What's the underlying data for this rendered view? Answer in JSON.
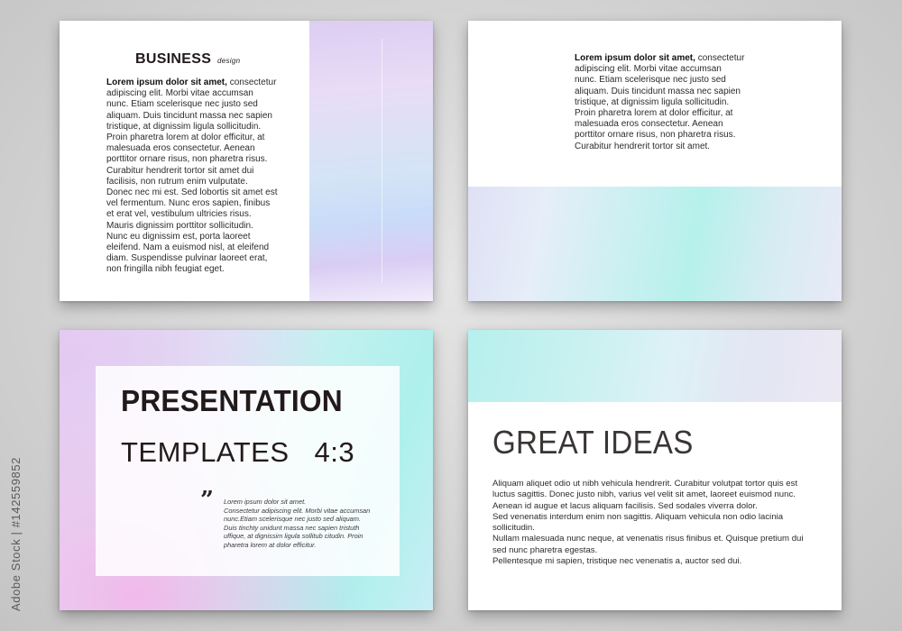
{
  "credit": "Adobe Stock | #142559852",
  "slide1": {
    "heading": "BUSINESS",
    "subheading": "design",
    "lead": "Lorem ipsum dolor sit amet,",
    "lines": [
      "adipiscing elit. Morbi vitae accumsan",
      "nunc. Etiam scelerisque nec justo sed",
      "aliquam. Duis tincidunt massa nec sapien",
      "tristique, at dignissim ligula sollicitudin.",
      "Proin pharetra lorem at dolor efficitur, at",
      "malesuada eros consectetur. Aenean",
      "porttitor ornare risus, non pharetra risus.",
      "Curabitur hendrerit tortor sit amet dui",
      "facilisis, non rutrum enim vulputate.",
      "Donec nec mi est. Sed lobortis sit amet est",
      "vel fermentum. Nunc eros sapien, finibus",
      "et erat vel, vestibulum ultricies risus.",
      "Mauris dignissim porttitor sollicitudin.",
      "Nunc eu dignissim est, porta laoreet",
      "eleifend. Nam a euismod nisl, at eleifend",
      "diam. Suspendisse pulvinar laoreet erat,",
      "non fringilla nibh feugiat eget."
    ],
    "lead_rest": " consectetur"
  },
  "slide2": {
    "lead": "Lorem ipsum dolor sit amet,",
    "lead_rest": " consectetur",
    "lines": [
      "adipiscing elit. Morbi vitae accumsan",
      "nunc. Etiam scelerisque nec justo sed",
      "aliquam. Duis tincidunt massa nec sapien",
      "tristique, at dignissim ligula sollicitudin.",
      "Proin pharetra lorem at dolor efficitur, at",
      "malesuada eros consectetur. Aenean",
      "porttitor ornare risus, non pharetra risus.",
      "Curabitur hendrerit tortor sit amet."
    ]
  },
  "slide3": {
    "title_line1": "PRESENTATION",
    "title_line2": "TEMPLATES",
    "ratio": "4:3",
    "quote_mark": "”",
    "quote_lines": [
      "Lorem ipsum dolor sit amet.",
      "Consectetur adipiscing elit. Morbi vitae accumsan",
      "nunc.Etiam scelerisque nec justo sed aliquam.",
      "Duis tinchty unidunt massa nec sapien tristuth",
      "uffique, at dignissim ligula sollitub citudin. Proin",
      "pharetra lorem at dolor efficitur."
    ]
  },
  "slide4": {
    "title": "GREAT IDEAS",
    "lines": [
      "Aliquam aliquet odio ut nibh vehicula hendrerit. Curabitur volutpat tortor quis est",
      "luctus sagittis. Donec justo nibh, varius vel velit sit amet, laoreet euismod nunc.",
      "Aenean id augue et lacus aliquam facilisis. Sed sodales viverra dolor.",
      "Sed venenatis interdum enim non sagittis. Aliquam vehicula non odio lacinia",
      "sollicitudin.",
      "Nullam malesuada nunc neque, at venenatis risus finibus et. Quisque pretium dui",
      "sed nunc pharetra egestas.",
      "Pellentesque mi sapien, tristique nec venenatis a, auctor sed dui."
    ]
  }
}
